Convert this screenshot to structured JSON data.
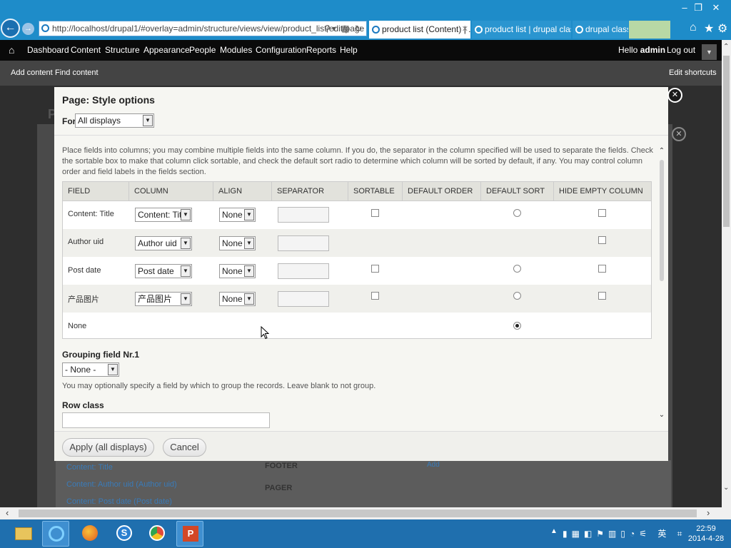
{
  "browser": {
    "url": "http://localhost/drupal1/#overlay=admin/structure/views/view/product_list/edit/page",
    "tabs": [
      {
        "label": "product list (Content) | ...",
        "active": true
      },
      {
        "label": "product list | drupal class",
        "active": false
      },
      {
        "label": "drupal class",
        "active": false
      }
    ]
  },
  "toolbar": {
    "items": [
      "Dashboard",
      "Content",
      "Structure",
      "Appearance",
      "People",
      "Modules",
      "Configuration",
      "Reports",
      "Help"
    ],
    "hello_prefix": "Hello ",
    "user": "admin",
    "logout": "Log out"
  },
  "shortcuts": {
    "add_content": "Add content",
    "find_content": "Find content",
    "edit_shortcuts": "Edit shortcuts"
  },
  "background": {
    "links": [
      "Content: Title",
      "Content: Author uid (Author uid)",
      "Content: Post date (Post date)"
    ],
    "footer": "FOOTER",
    "add": "Add",
    "pager": "PAGER"
  },
  "dialog": {
    "title": "Page: Style options",
    "for_label": "For",
    "for_value": "All displays",
    "description": "Place fields into columns; you may combine multiple fields into the same column. If you do, the separator in the column specified will be used to separate the fields. Check the sortable box to make that column click sortable, and check the default sort radio to determine which column will be sorted by default, if any. You may control column order and field labels in the fields section.",
    "headers": [
      "FIELD",
      "COLUMN",
      "ALIGN",
      "SEPARATOR",
      "SORTABLE",
      "DEFAULT ORDER",
      "DEFAULT SORT",
      "HIDE EMPTY COLUMN"
    ],
    "rows": [
      {
        "field": "Content: Title",
        "column": "Content: Title",
        "align": "None"
      },
      {
        "field": "Author uid",
        "column": "Author uid",
        "align": "None"
      },
      {
        "field": "Post date",
        "column": "Post date",
        "align": "None"
      },
      {
        "field": "产品图片",
        "column": "产品图片",
        "align": "None"
      },
      {
        "field": "None"
      }
    ],
    "grouping_label": "Grouping field Nr.1",
    "grouping_value": "- None -",
    "grouping_help": "You may optionally specify a field by which to group the records. Leave blank to not group.",
    "row_class_label": "Row class",
    "apply_button": "Apply (all displays)",
    "cancel_button": "Cancel"
  },
  "taskbar": {
    "time": "22:59",
    "date": "2014-4-28"
  },
  "colors": {
    "browser_blue": "#1e8cc9",
    "toolbar_black": "#0a0a0a",
    "taskbar_blue": "#1f6fae"
  }
}
